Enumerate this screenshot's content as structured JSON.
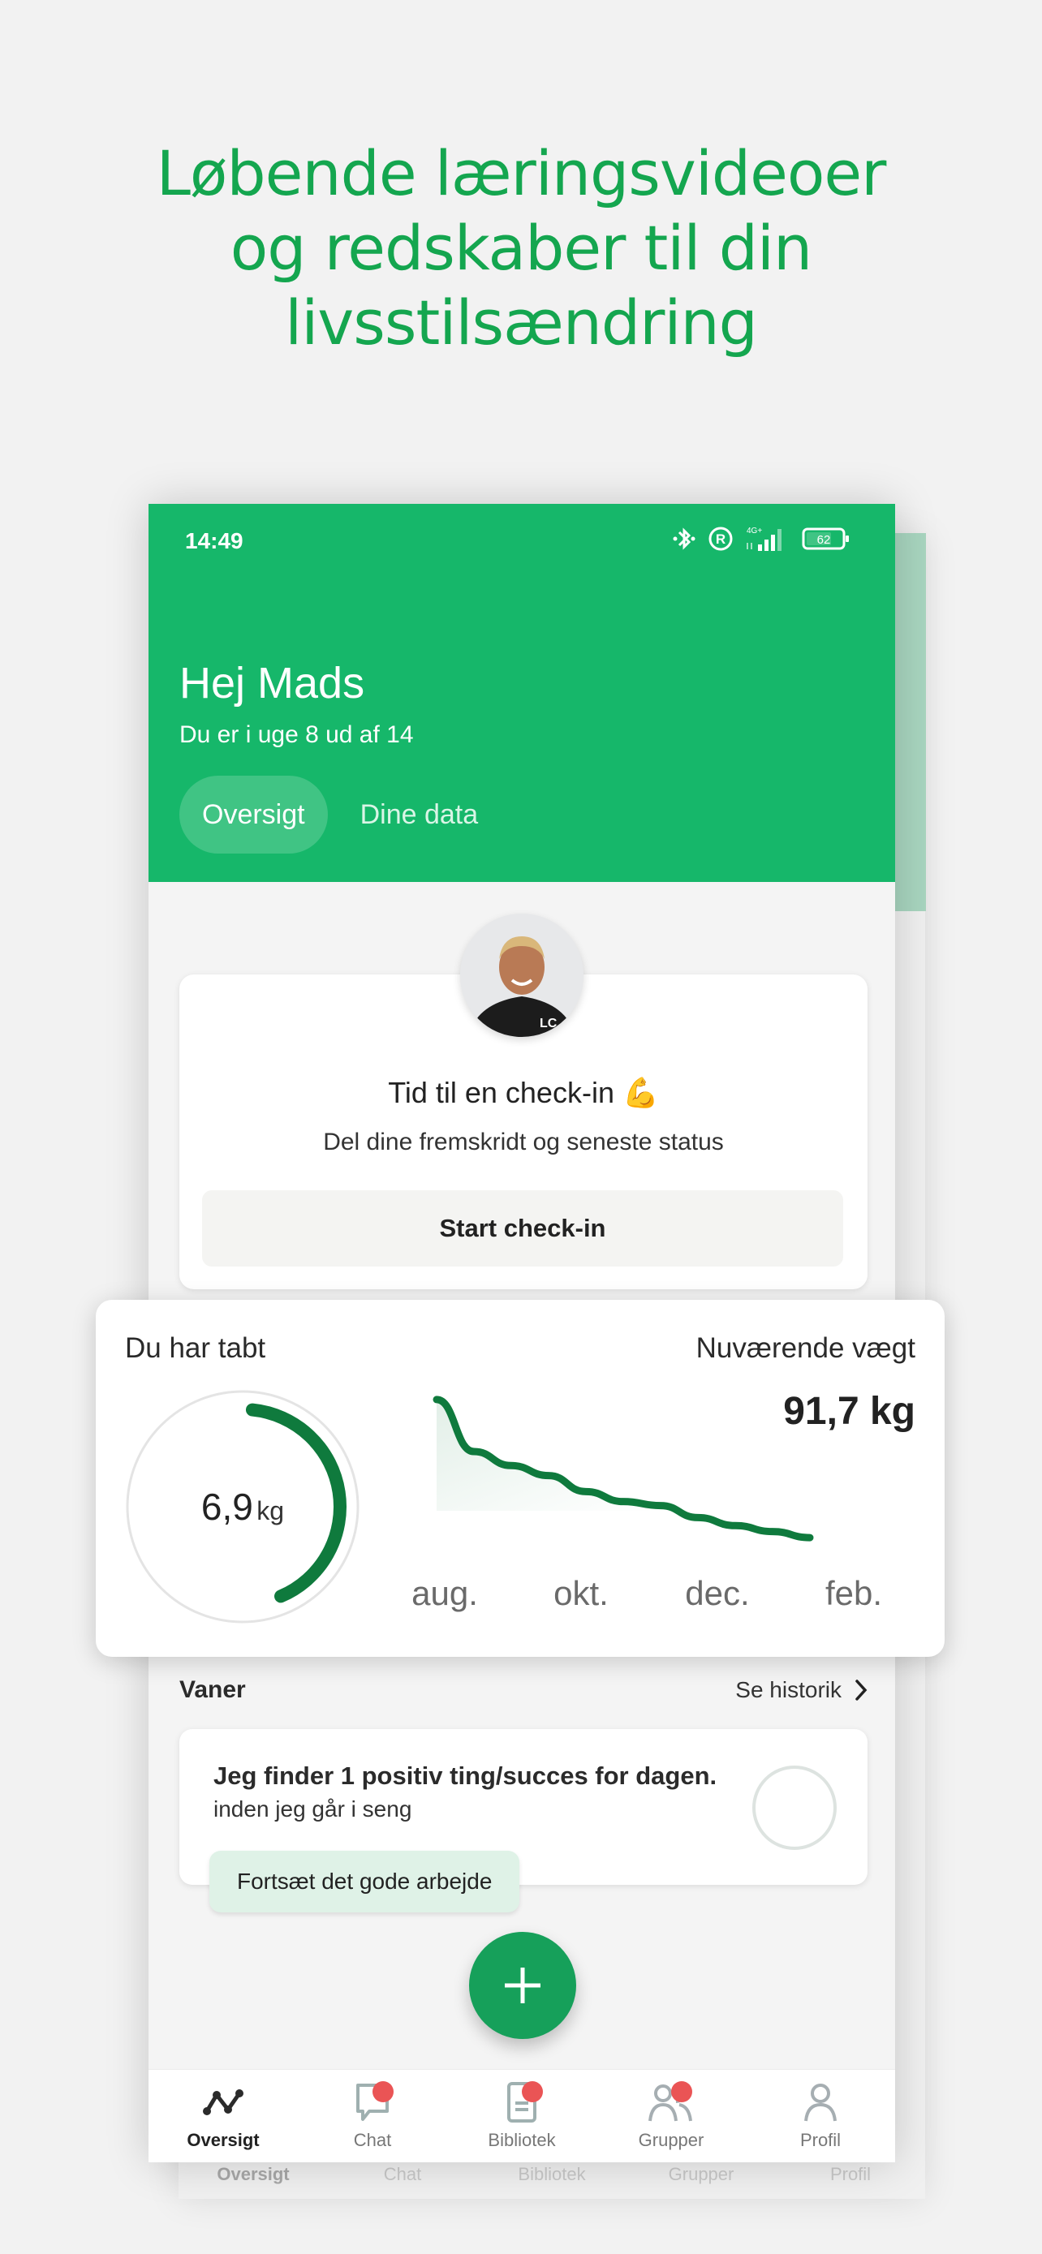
{
  "headline": [
    "Løbende læringsvideoer",
    "og redskaber til din",
    "livsstilsændring"
  ],
  "status_bar": {
    "time": "14:49",
    "network": "4G+",
    "battery": "62",
    "icons": [
      "bluetooth-icon",
      "registered-icon",
      "signal-icon",
      "battery-icon"
    ]
  },
  "header": {
    "greeting": "Hej Mads",
    "week_text": "Du er i uge 8 ud af 14",
    "tabs": [
      {
        "label": "Oversigt",
        "active": true
      },
      {
        "label": "Dine data",
        "active": false
      }
    ]
  },
  "checkin": {
    "title": "Tid til en check-in 💪",
    "subtitle": "Del dine fremskridt og seneste status",
    "button_label": "Start check-in"
  },
  "weight": {
    "lost_label": "Du har tabt",
    "lost_value": "6,9",
    "lost_unit": "kg",
    "lost_progress_fraction": 0.42,
    "current_label": "Nuværende vægt",
    "current_value": "91,7 kg"
  },
  "chart_data": {
    "type": "area",
    "title": "",
    "categories": [
      "aug.",
      "okt.",
      "dec.",
      "feb."
    ],
    "x": [
      0,
      0.3,
      0.6,
      0.9,
      1.2,
      1.5,
      1.8,
      2.1,
      2.4,
      2.7,
      3.0
    ],
    "values": [
      98.6,
      96.0,
      95.3,
      94.8,
      94.0,
      93.5,
      93.3,
      92.7,
      92.3,
      92.0,
      91.7
    ],
    "xlabel": "",
    "ylabel": "",
    "ylim": [
      91.5,
      98.8
    ],
    "grid": false,
    "legend": "none",
    "color": "#0f7a3d"
  },
  "habits": {
    "title": "Vaner",
    "history_link": "Se historik",
    "items": [
      {
        "title": "Jeg finder 1 positiv ting/succes for dagen.",
        "subtitle": "inden jeg går i seng",
        "done": false
      }
    ],
    "encouragement": "Fortsæt det gode arbejde"
  },
  "fab": {
    "icon": "plus-icon"
  },
  "bottom_nav": [
    {
      "label": "Oversigt",
      "icon": "overview-graph-icon",
      "active": true,
      "badge": false
    },
    {
      "label": "Chat",
      "icon": "chat-bubble-icon",
      "active": false,
      "badge": true
    },
    {
      "label": "Bibliotek",
      "icon": "document-icon",
      "active": false,
      "badge": true
    },
    {
      "label": "Grupper",
      "icon": "group-icon",
      "active": false,
      "badge": true
    },
    {
      "label": "Profil",
      "icon": "profile-icon",
      "active": false,
      "badge": false
    }
  ],
  "colors": {
    "brand_green": "#16b76a",
    "headline_green": "#14a64f",
    "chart_green": "#0f7a3d",
    "badge_red": "#ea5455"
  }
}
